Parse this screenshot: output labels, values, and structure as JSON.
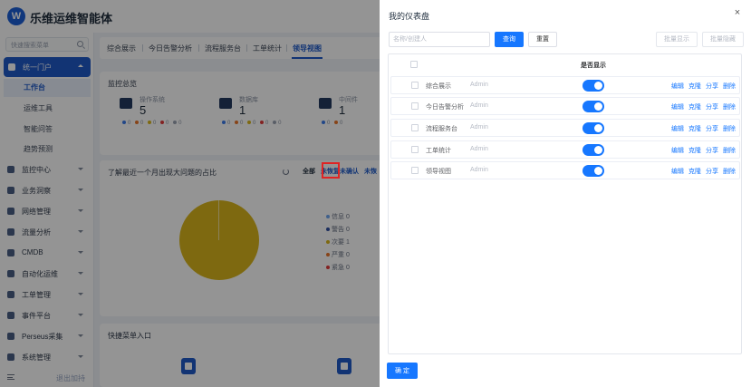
{
  "app": {
    "brand": "乐维运维智能体",
    "logo_text": "W"
  },
  "sidebar": {
    "search_placeholder": "快速搜索菜单",
    "items": [
      {
        "label": "统一门户",
        "icon": "home-icon"
      },
      {
        "label": "监控中心",
        "icon": "monitor-icon"
      },
      {
        "label": "业务洞察",
        "icon": "business-icon"
      },
      {
        "label": "网络管理",
        "icon": "network-icon"
      },
      {
        "label": "流量分析",
        "icon": "traffic-icon"
      },
      {
        "label": "CMDB",
        "icon": "database-icon"
      },
      {
        "label": "自动化运维",
        "icon": "automation-icon"
      },
      {
        "label": "工单管理",
        "icon": "ticket-icon"
      },
      {
        "label": "事件平台",
        "icon": "event-icon"
      },
      {
        "label": "Perseus采集",
        "icon": "collect-icon"
      },
      {
        "label": "系统管理",
        "icon": "settings-icon"
      }
    ],
    "sub_items": [
      "工作台",
      "运维工具",
      "智能问答",
      "趋势预测"
    ],
    "footer_label": "退出加持"
  },
  "tabs": [
    "综合展示",
    "今日告警分析",
    "流程服务台",
    "工单统计",
    "领导视图"
  ],
  "monitor": {
    "title": "监控总览",
    "stats": [
      {
        "name": "操作系统",
        "value": "5",
        "icon": "server-icon"
      },
      {
        "name": "数据库",
        "value": "1",
        "icon": "database-icon"
      },
      {
        "name": "中间件",
        "value": "1",
        "icon": "middleware-icon"
      }
    ],
    "dot_counts": [
      "0",
      "0",
      "0",
      "0",
      "0"
    ],
    "dot_colors": [
      "#3b7bea",
      "#e8762c",
      "#d9b61c",
      "#e23c3c",
      "#9aa3b1"
    ]
  },
  "pie_card": {
    "title": "了解最近一个月出现大问题的占比",
    "filters": [
      "全部",
      "未恢复未确认",
      "未恢"
    ],
    "legend": [
      {
        "label": "信息",
        "value": "0",
        "color": "#6fa6f0"
      },
      {
        "label": "警告",
        "value": "0",
        "color": "#2f4fa0"
      },
      {
        "label": "次要",
        "value": "1",
        "color": "#d9b61c"
      },
      {
        "label": "严重",
        "value": "0",
        "color": "#e8762c"
      },
      {
        "label": "紧急",
        "value": "0",
        "color": "#e23c3c"
      }
    ]
  },
  "quick_card": {
    "title": "快捷菜单入口"
  },
  "drawer": {
    "title": "我的仪表盘",
    "close_glyph": "×",
    "search": {
      "placeholder": "名称/创建人",
      "value": ""
    },
    "buttons": {
      "query": "查询",
      "reset": "重置",
      "batch_show": "批量显示",
      "batch_hide": "批量隐藏",
      "confirm": "确 定"
    },
    "column_header": "是否显示",
    "actions": {
      "edit": "编辑",
      "clone": "克隆",
      "share": "分享",
      "delete": "删除"
    },
    "rows": [
      {
        "name": "综合展示",
        "owner": "Admin",
        "visible": true
      },
      {
        "name": "今日告警分析",
        "owner": "Admin",
        "visible": true
      },
      {
        "name": "流程服务台",
        "owner": "Admin",
        "visible": true
      },
      {
        "name": "工单统计",
        "owner": "Admin",
        "visible": true
      },
      {
        "name": "领导视图",
        "owner": "Admin",
        "visible": true
      }
    ],
    "highlight_color": "#e02424",
    "accent_color": "#1677ff"
  }
}
